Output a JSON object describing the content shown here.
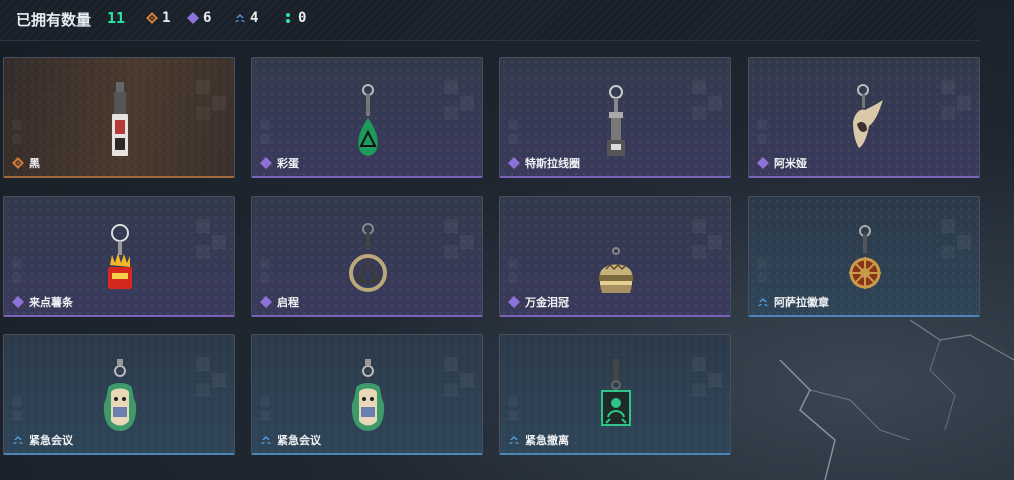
{
  "header": {
    "title": "已拥有数量",
    "total": "11",
    "rarities": [
      {
        "icon": "orange-diamond-icon",
        "color": "#d07b3a",
        "count": "1"
      },
      {
        "icon": "purple-diamond-icon",
        "color": "#8f72d8",
        "count": "6"
      },
      {
        "icon": "blue-chevron-icon",
        "color": "#4f9be0",
        "count": "4"
      },
      {
        "icon": "green-dots-icon",
        "color": "#2ee6a0",
        "count": "0"
      }
    ]
  },
  "cards": [
    {
      "name": "黑",
      "rarity": "orange",
      "icon": "orange-diamond-icon",
      "charm": "black-tag-charm-icon"
    },
    {
      "name": "彩蛋",
      "rarity": "purple",
      "icon": "purple-diamond-icon",
      "charm": "green-egg-charm-icon"
    },
    {
      "name": "特斯拉线圈",
      "rarity": "purple",
      "icon": "purple-diamond-icon",
      "charm": "tesla-coil-charm-icon"
    },
    {
      "name": "阿米娅",
      "rarity": "purple",
      "icon": "purple-diamond-icon",
      "charm": "amiya-ears-charm-icon"
    },
    {
      "name": "来点薯条",
      "rarity": "purple",
      "icon": "purple-diamond-icon",
      "charm": "fries-charm-icon"
    },
    {
      "name": "启程",
      "rarity": "purple",
      "icon": "purple-diamond-icon",
      "charm": "triangle-ring-charm-icon"
    },
    {
      "name": "万金泪冠",
      "rarity": "purple",
      "icon": "purple-diamond-icon",
      "charm": "burger-crown-charm-icon"
    },
    {
      "name": "阿萨拉徽章",
      "rarity": "blue",
      "icon": "blue-chevron-icon",
      "charm": "wheel-badge-charm-icon"
    },
    {
      "name": "紧急会议",
      "rarity": "blue",
      "icon": "blue-chevron-icon",
      "charm": "meeting-figure-charm-icon"
    },
    {
      "name": "紧急会议",
      "rarity": "blue",
      "icon": "blue-chevron-icon",
      "charm": "meeting-figure-charm-icon"
    },
    {
      "name": "紧急撤离",
      "rarity": "blue",
      "icon": "blue-chevron-icon",
      "charm": "green-plaque-charm-icon"
    }
  ]
}
